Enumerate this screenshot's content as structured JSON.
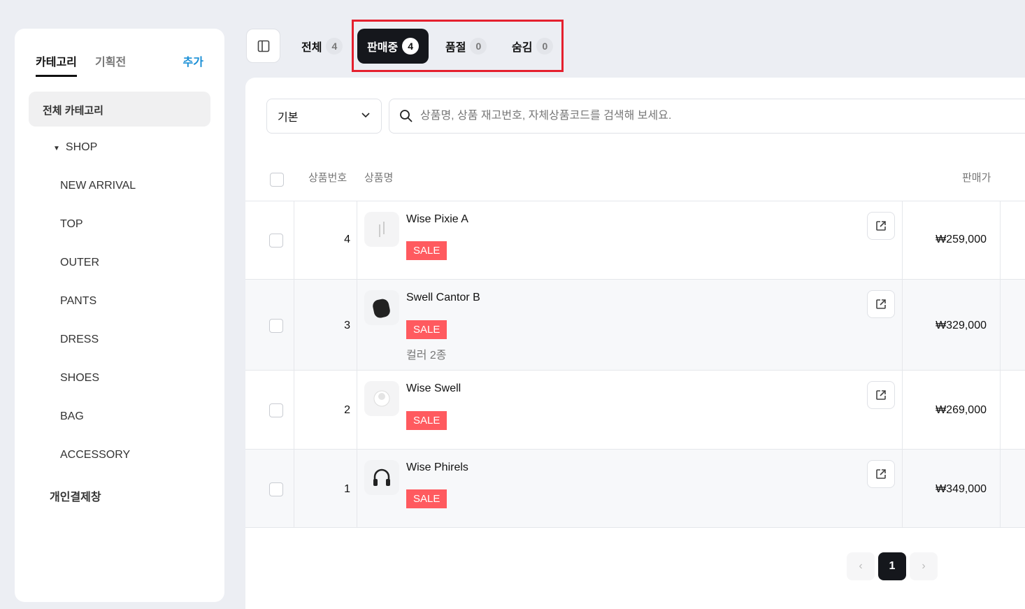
{
  "sidebar": {
    "tabs": [
      "카테고리",
      "기획전"
    ],
    "add_label": "추가",
    "all_categories": "전체 카테고리",
    "shop": "SHOP",
    "categories": [
      "NEW ARRIVAL",
      "TOP",
      "OUTER",
      "PANTS",
      "DRESS",
      "SHOES",
      "BAG",
      "ACCESSORY"
    ],
    "private_payment": "개인결제창"
  },
  "status_tabs": [
    {
      "label": "전체",
      "count": "4"
    },
    {
      "label": "판매중",
      "count": "4"
    },
    {
      "label": "품절",
      "count": "0"
    },
    {
      "label": "숨김",
      "count": "0"
    }
  ],
  "filter": {
    "sort": "기본",
    "search_placeholder": "상품명, 상품 재고번호, 자체상품코드를 검색해 보세요."
  },
  "table": {
    "headers": [
      "상품번호",
      "상품명",
      "판매가"
    ],
    "rows": [
      {
        "no": "4",
        "name": "Wise Pixie A",
        "badge": "SALE",
        "option": "",
        "price": "₩259,000"
      },
      {
        "no": "3",
        "name": "Swell Cantor B",
        "badge": "SALE",
        "option": "컬러 2종",
        "price": "₩329,000"
      },
      {
        "no": "2",
        "name": "Wise Swell",
        "badge": "SALE",
        "option": "",
        "price": "₩269,000"
      },
      {
        "no": "1",
        "name": "Wise Phirels",
        "badge": "SALE",
        "option": "",
        "price": "₩349,000"
      }
    ]
  },
  "pagination": {
    "current": "1"
  },
  "colors": {
    "sale": "#ff5a5f",
    "accent": "#1a8fd6",
    "active_tab": "#15171c"
  }
}
